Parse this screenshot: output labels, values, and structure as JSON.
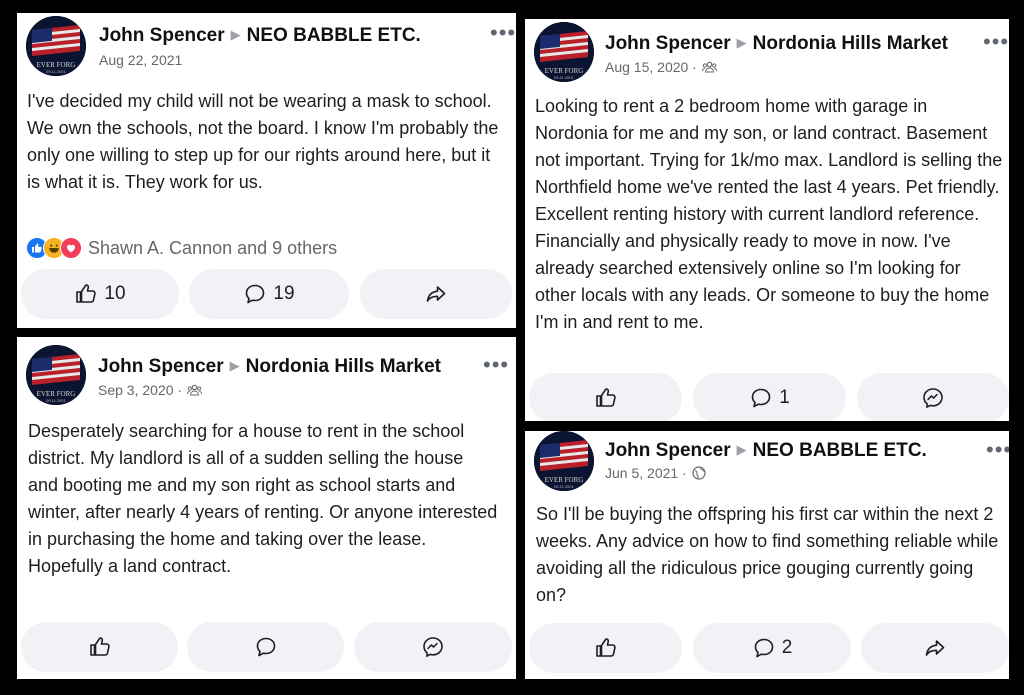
{
  "avatar": {
    "caption_top": "EVER FORG",
    "caption_bottom": "09.11.2001"
  },
  "posts": [
    {
      "author": "John Spencer",
      "group": "NEO BABBLE ETC.",
      "date": "Aug 22, 2021",
      "privacy_icon": "",
      "text": "I've decided my child will not be wearing a mask to school. We own the schools, not the board. I know I'm probably the only one willing to step up for our rights around here, but it is what it is. They work for us.",
      "reactions": {
        "icons": [
          "like-icon",
          "haha-icon",
          "love-icon"
        ],
        "summary": "Shawn A. Cannon and 9 others"
      },
      "actions": {
        "like_count": "10",
        "comment_count": "19",
        "third": "share-icon"
      }
    },
    {
      "author": "John Spencer",
      "group": "Nordonia Hills Market",
      "date": "Aug 15, 2020 ·",
      "privacy_icon": "group-members-icon",
      "text": "Looking to rent a 2 bedroom home with garage in Nordonia for me and my son, or land contract. Basement not important. Trying for 1k/mo max. Landlord is selling the Northfield home we've rented the last 4 years. Pet friendly. Excellent renting history with current landlord reference. Financially and physically ready to move in now. I've already searched extensively online so I'm looking for other locals with any leads. Or someone to buy the home I'm in and rent to me.",
      "actions": {
        "like_count": "",
        "comment_count": "1",
        "third": "messenger-icon"
      }
    },
    {
      "author": "John Spencer",
      "group": "Nordonia Hills Market",
      "date": "Sep 3, 2020 ·",
      "privacy_icon": "group-members-icon",
      "text": "Desperately searching for a house to rent in the school district. My landlord is all of a sudden selling the house and booting me and my son right as school starts and winter, after nearly 4 years of renting. Or anyone interested in purchasing the home and taking over the lease. Hopefully a land contract.",
      "actions": {
        "like_count": "",
        "comment_count": "",
        "third": "messenger-icon"
      }
    },
    {
      "author": "John Spencer",
      "group": "NEO BABBLE ETC.",
      "date": "Jun 5, 2021 ·",
      "privacy_icon": "globe-icon",
      "text": "So I'll be buying the offspring his first car within the next 2 weeks. Any advice on how to find something reliable while avoiding all the ridiculous price gouging currently going on?",
      "actions": {
        "like_count": "",
        "comment_count": "2",
        "third": "share-icon"
      }
    }
  ],
  "more_glyph": "•••",
  "colors": {
    "like_blue": "#1877f2",
    "haha_yellow": "#f7b125",
    "love_red": "#f33e58",
    "button_bg": "#f0f2f5",
    "meta_gray": "#65676b"
  }
}
